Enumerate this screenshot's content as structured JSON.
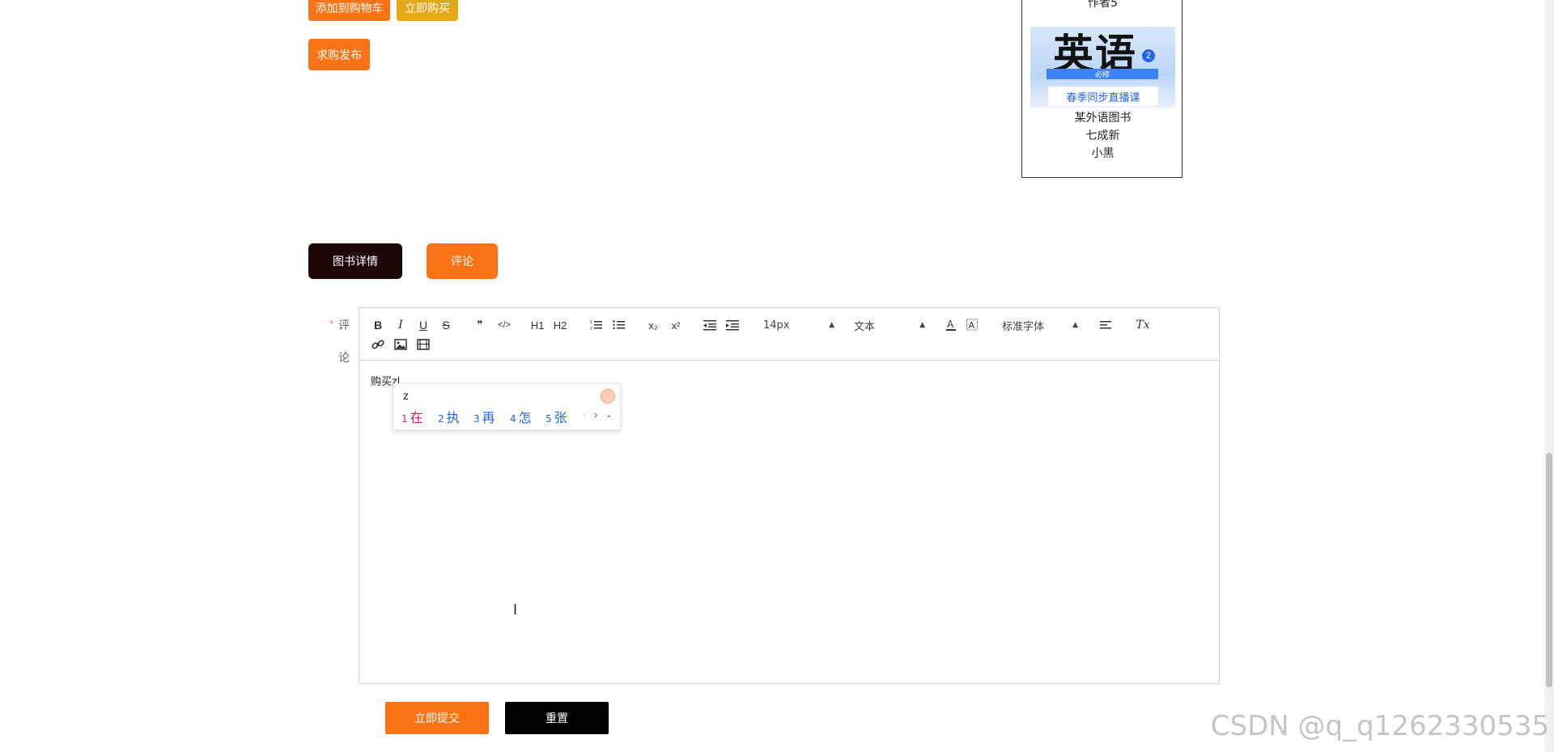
{
  "actions": {
    "add_to_cart": "添加到购物车",
    "buy_now": "立即购买",
    "post_request": "求购发布"
  },
  "product_card": {
    "top_text": "作者5",
    "cover_title": "英语",
    "cover_badge": "2",
    "cover_band": "必修",
    "cover_subtitle": "春季同步直播课",
    "publisher": "某外语图书",
    "condition": "七成新",
    "seller": "小黑"
  },
  "tabs": {
    "details": "图书详情",
    "comments": "评论"
  },
  "form": {
    "required_mark": "*",
    "comment_label_1": "评",
    "comment_label_2": "论"
  },
  "toolbar": {
    "bold": "B",
    "italic": "I",
    "underline": "U",
    "strike": "S",
    "quote": "❞",
    "code": "</>",
    "h1": "H1",
    "h2": "H2",
    "sub": "x₂",
    "sup": "x²",
    "font_size": "14px",
    "text_type": "文本",
    "font_family": "标准字体",
    "clean": "Tx"
  },
  "editor": {
    "content": "购买z"
  },
  "ime": {
    "input": "z",
    "candidates": [
      {
        "n": "1",
        "c": "在"
      },
      {
        "n": "2",
        "c": "执"
      },
      {
        "n": "3",
        "c": "再"
      },
      {
        "n": "4",
        "c": "怎"
      },
      {
        "n": "5",
        "c": "张"
      }
    ]
  },
  "submit": {
    "submit_label": "立即提交",
    "reset_label": "重置"
  },
  "watermark": "CSDN @q_q1262330535",
  "colors": {
    "orange": "#f97316",
    "gold": "#e6a817",
    "dark": "#1f0707"
  }
}
